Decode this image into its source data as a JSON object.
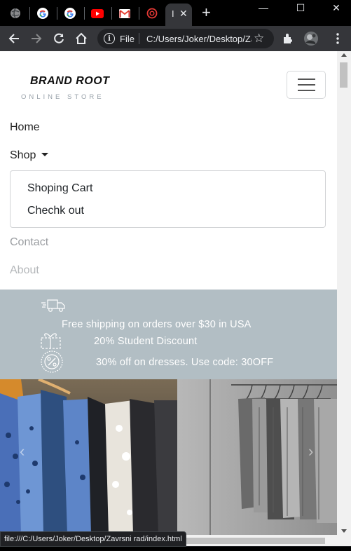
{
  "browser": {
    "tabs": [
      {
        "icon": "globe-icon"
      },
      {
        "icon": "google-icon"
      },
      {
        "icon": "google-icon"
      },
      {
        "icon": "youtube-icon"
      },
      {
        "icon": "gmail-icon"
      },
      {
        "icon": "red-circle-icon"
      }
    ],
    "active_tab": {
      "label": "I",
      "close": "✕"
    },
    "new_tab": "+",
    "window": {
      "minimize": "—",
      "maximize": "☐",
      "close": "✕"
    },
    "omnibox": {
      "scheme": "File",
      "url": "C:/Users/Joker/Desktop/Zavrsni rad/index.html"
    },
    "status_url": "file:///C:/Users/Joker/Desktop/Zavrsni rad/index.html"
  },
  "page": {
    "brand": {
      "name": "BRAND ROOT",
      "tagline": "ONLINE STORE"
    },
    "nav": {
      "home": "Home",
      "shop": "Shop",
      "dropdown": [
        "Shoping Cart",
        "Chechk out"
      ],
      "contact": "Contact",
      "about": "About"
    },
    "promo": {
      "shipping": "Free shipping on orders over $30 in USA",
      "student": "20% Student Discount",
      "dresses": "30% off on dresses. Use code: 30OFF"
    },
    "carousel": {
      "prev": "‹",
      "next": "›"
    }
  },
  "colors": {
    "promo_bg": "#b2bec4",
    "nav_inactive": "#9a9da1",
    "nav_active": "#222222"
  }
}
